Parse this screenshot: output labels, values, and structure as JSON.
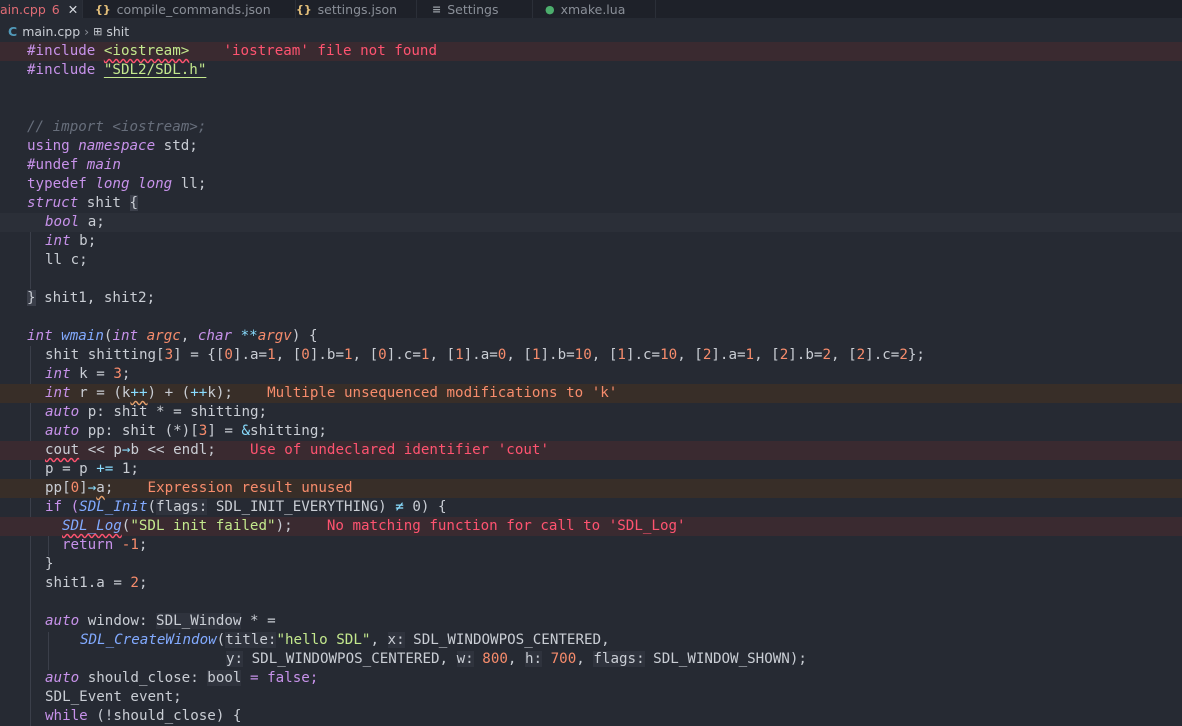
{
  "tabs": [
    {
      "label": "ain.cpp",
      "count": "6",
      "close": "✕",
      "icon": "none",
      "active": true
    },
    {
      "label": "compile_commands.json",
      "icon_text": "{}",
      "icon": "json-braces-icon"
    },
    {
      "label": "settings.json",
      "icon_text": "{}",
      "icon": "json-braces-icon"
    },
    {
      "label": "Settings",
      "icon_text": "≡",
      "icon": "settings-list-icon"
    },
    {
      "label": "xmake.lua",
      "icon_text": "●",
      "icon": "lua-globe-icon"
    }
  ],
  "breadcrumb": {
    "file_icon": "C",
    "file": "main.cpp",
    "sep": "›",
    "symbol_icon": "⊞",
    "symbol": "shit"
  },
  "code": {
    "l1": {
      "a": "#include ",
      "b": "<iostream>",
      "c": "    ",
      "msg": "'iostream' file not found"
    },
    "l2": {
      "a": "#include ",
      "b": "\"SDL2/SDL.h\""
    },
    "l5": "// import <iostream>;",
    "l6": {
      "a": "using ",
      "b": "namespace",
      "c": " std;"
    },
    "l7": {
      "a": "#undef ",
      "b": "main"
    },
    "l8": {
      "a": "typedef ",
      "b": "long long",
      "c": " ll;"
    },
    "l9": {
      "a": "struct",
      "b": " shit ",
      "c": "{"
    },
    "l10": {
      "a": "bool",
      "b": " a;"
    },
    "l11": {
      "a": "int",
      "b": " b;"
    },
    "l12": "ll c;",
    "l14": {
      "a": "}",
      "b": " shit1, shit2;"
    },
    "l16": {
      "a": "int ",
      "b": "wmain",
      "c": "(",
      "d": "int ",
      "e": "argc",
      ",": ", ",
      "f": "char ",
      "g": "**",
      "h": "argv",
      "i": ") {"
    },
    "l17": {
      "a": "shit shitting[",
      "b": "3",
      "c": "] = {[",
      "d": "0",
      "e": "].a=",
      "f": "1",
      "g": ", [",
      "h": "0",
      "i": "].b=",
      "j": "1",
      "k": ", [",
      "l": "0",
      "m": "].c=",
      "n": "1",
      "o": ", [",
      "p": "1",
      "q": "].a=",
      "r": "0",
      "s": ", [",
      "t": "1",
      "u": "].b=",
      "v": "10",
      "w": ", [",
      "x": "1",
      "y": "].c=",
      "z": "10",
      "aa": ", [",
      "ab": "2",
      "ac": "].a=",
      "ad": "1",
      "ae": ", [",
      "af": "2",
      "ag": "].b=",
      "ah": "2",
      "ai": ", [",
      "aj": "2",
      "ak": "].c=",
      "al": "2",
      "am": "};"
    },
    "l18": {
      "a": "int",
      "b": " k = ",
      "c": "3",
      "d": ";"
    },
    "l19": {
      "a": "int",
      "b": " r = (k",
      "c": "++",
      "d": ") + (",
      "e": "++",
      "f": "k);",
      "msg": "Multiple unsequenced modifications to 'k'"
    },
    "l20": {
      "a": "auto",
      "b": " p: shit * = shitting;"
    },
    "l21": {
      "a": "auto",
      "b": " pp: shit (*)[",
      "c": "3",
      "d": "] = ",
      "e": "&",
      "f": "shitting;"
    },
    "l22": {
      "a": "cout",
      "b": " << p",
      "c": "→",
      "d": "b << endl;",
      "msg": "Use of undeclared identifier 'cout'"
    },
    "l23": {
      "a": "p = p ",
      "b": "+=",
      "c": " 1;"
    },
    "l24": {
      "a": "pp[",
      "b": "0",
      "c": "]",
      "d": "→",
      "e": "a",
      "f": ";",
      "msg": "Expression result unused"
    },
    "l25": {
      "a": "if (",
      "b": "SDL_Init",
      "c": "(",
      "d": "flags:",
      "e": " SDL_INIT_EVERYTHING",
      "f": ") ",
      "g": "≠",
      "h": " 0) {"
    },
    "l26": {
      "a": "SDL_Log",
      "b": "(",
      "c": "\"SDL init failed\"",
      "d": ");",
      "msg": "No matching function for call to 'SDL_Log'"
    },
    "l27": {
      "a": "return ",
      "b": "-1",
      ";": ";"
    },
    "l28": "}",
    "l29": {
      "a": "shit1.a = ",
      "b": "2",
      ";": ";"
    },
    "l31": {
      "a": "auto",
      "b": " window: ",
      "c": "SDL_Window",
      "d": " * ="
    },
    "l32": {
      "a": "SDL_CreateWindow",
      "b": "(",
      "c": "title:",
      "d": "\"hello SDL\"",
      "e": ", ",
      "f": "x:",
      "g": " SDL_WINDOWPOS_CENTERED,"
    },
    "l33": {
      "a": "y:",
      "b": " SDL_WINDOWPOS_CENTERED, ",
      "c": "w:",
      "d": " 800",
      ", ": ", ",
      "e": "h:",
      "f": " 700",
      ",,": ", ",
      "g": "flags:",
      "h": " SDL_WINDOW_SHOWN);"
    },
    "l34": {
      "a": "auto",
      "b": " should_close: ",
      "c": "bool",
      "d": " = false;"
    },
    "l35": "SDL_Event event;",
    "l36": {
      "a": "while",
      "b": " (!should_close) {"
    }
  }
}
